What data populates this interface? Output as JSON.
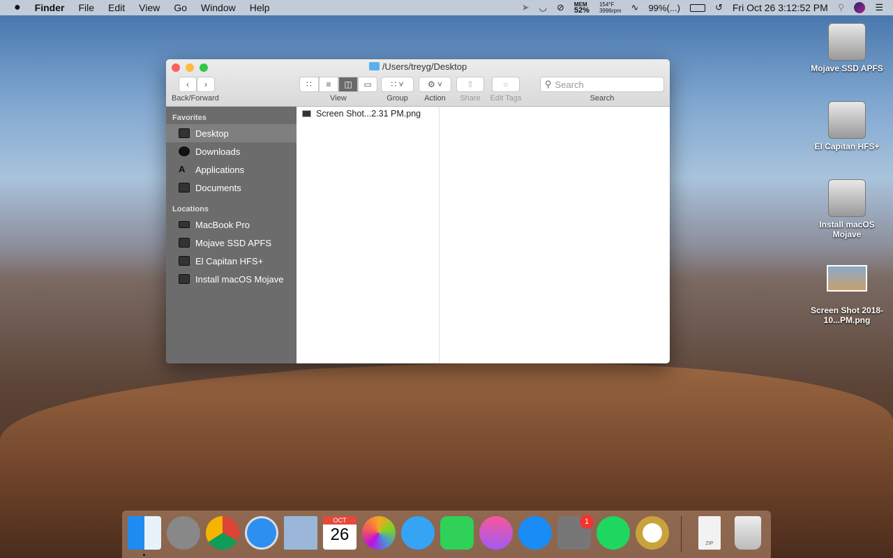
{
  "menubar": {
    "apple": "",
    "app": "Finder",
    "items": [
      "File",
      "Edit",
      "View",
      "Go",
      "Window",
      "Help"
    ],
    "status": {
      "mem_label": "MEM",
      "mem": "52%",
      "temp": "154°F",
      "fan": "3996rpm",
      "battery": "99%(...)",
      "clock": "Fri Oct 26  3:12:52 PM"
    }
  },
  "window": {
    "title": "/Users/treyg/Desktop",
    "toolbar": {
      "back_forward": "Back/Forward",
      "view": "View",
      "group": "Group",
      "action": "Action",
      "share": "Share",
      "edit_tags": "Edit Tags",
      "search_label": "Search",
      "search_placeholder": "Search"
    },
    "sidebar": {
      "favorites": "Favorites",
      "fav_items": [
        "Desktop",
        "Downloads",
        "Applications",
        "Documents"
      ],
      "locations": "Locations",
      "loc_items": [
        "MacBook Pro",
        "Mojave SSD APFS",
        "El Capitan HFS+",
        "Install macOS Mojave"
      ]
    },
    "files": [
      "Screen Shot...2.31 PM.png"
    ]
  },
  "desktop": {
    "icons": [
      "Mojave SSD APFS",
      "El Capitan HFS+",
      "Install macOS Mojave",
      "Screen Shot 2018-10...PM.png"
    ]
  },
  "dock": {
    "apps": [
      "Finder",
      "Launchpad",
      "Chrome",
      "Safari",
      "Mail",
      "Calendar",
      "Photos",
      "Messages",
      "FaceTime",
      "iTunes",
      "App Store",
      "System Preferences",
      "Spotify",
      "Time Machine",
      "Archive",
      "Trash"
    ],
    "calendar_month": "OCT",
    "calendar_day": "26",
    "prefs_badge": "1",
    "zip": "ZIP"
  }
}
